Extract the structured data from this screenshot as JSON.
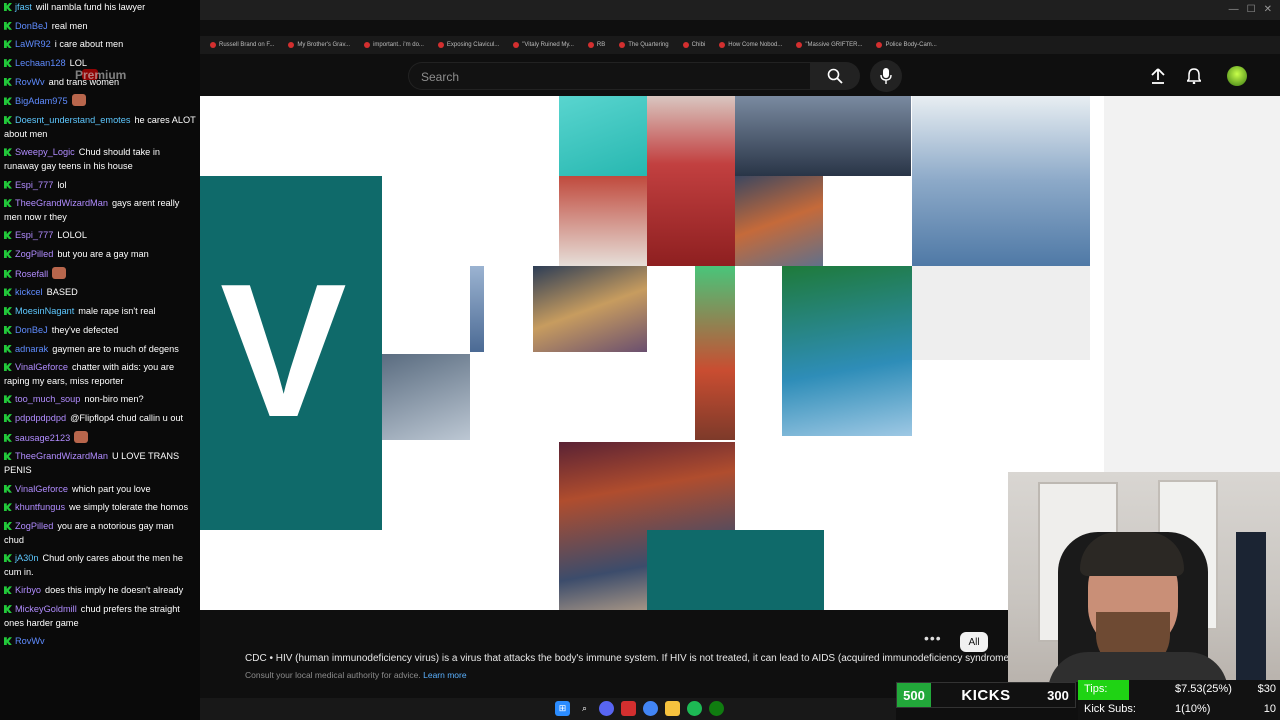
{
  "chat": {
    "messages": [
      {
        "user": "jfast",
        "text": "will nambla fund his lawyer",
        "uc": "c4"
      },
      {
        "user": "DonBeJ",
        "text": "real men",
        "uc": ""
      },
      {
        "user": "LaWR92",
        "text": "i care about men",
        "uc": ""
      },
      {
        "user": "Lechaan128",
        "text": "LOL",
        "uc": ""
      },
      {
        "user": "RovWv",
        "text": "and trans women",
        "uc": ""
      },
      {
        "user": "BigAdam975",
        "text": "",
        "uc": "",
        "emote": true
      },
      {
        "user": "Doesnt_understand_emotes",
        "text": "he cares ALOT about men",
        "uc": "c4"
      },
      {
        "user": "Sweepy_Logic",
        "text": "Chud should take in runaway gay teens in his house",
        "uc": "c3"
      },
      {
        "user": "Espi_777",
        "text": "lol",
        "uc": "c3"
      },
      {
        "user": "TheeGrandWizardMan",
        "text": "gays arent really men now r they",
        "uc": "c3"
      },
      {
        "user": "Espi_777",
        "text": "LOLOL",
        "uc": "c3"
      },
      {
        "user": "ZogPilled",
        "text": "but you are a gay man",
        "uc": "c3"
      },
      {
        "user": "Rosefall",
        "text": "",
        "uc": "c3",
        "emote": true
      },
      {
        "user": "kickcel",
        "text": "BASED",
        "uc": ""
      },
      {
        "user": "MoesinNagant",
        "text": "male rape isn't real",
        "uc": "c4"
      },
      {
        "user": "DonBeJ",
        "text": "they've defected",
        "uc": ""
      },
      {
        "user": "adnarak",
        "text": "gaymen are to much of degens",
        "uc": ""
      },
      {
        "user": "VinalGeforce",
        "text": "chatter with aids: you are raping my ears, miss reporter",
        "uc": "c3"
      },
      {
        "user": "too_much_soup",
        "text": "non-biro men?",
        "uc": "c3"
      },
      {
        "user": "pdpdpdpdpd",
        "text": "@Flipflop4 chud callin u out",
        "uc": "c3"
      },
      {
        "user": "sausage2123",
        "text": "",
        "uc": "c3",
        "emote": true
      },
      {
        "user": "TheeGrandWizardMan",
        "text": "U LOVE TRANS PENIS",
        "uc": "c3"
      },
      {
        "user": "VinalGeforce",
        "text": "which part you love",
        "uc": "c3"
      },
      {
        "user": "khuntfungus",
        "text": "we simply tolerate the homos",
        "uc": "c3"
      },
      {
        "user": "ZogPilled",
        "text": "you are a notorious gay man chud",
        "uc": "c3"
      },
      {
        "user": "jA30n",
        "text": "Chud only cares about the men he cum in.",
        "uc": "c4"
      },
      {
        "user": "Kirbyo",
        "text": "does this imply he doesn't already",
        "uc": "c3"
      },
      {
        "user": "MickeyGoldmill",
        "text": "chud prefers the straight ones harder game",
        "uc": "c3"
      },
      {
        "user": "RovWv",
        "text": "",
        "uc": ""
      }
    ]
  },
  "browser": {
    "bookmarks": [
      "Russell Brand on F...",
      "My Brother's Grav...",
      "important.. i'm do...",
      "Exposing Clavicul...",
      "\"Vitaly Ruined My...",
      "RB",
      "The Quartering",
      "Chibi",
      "How Come Nobod...",
      "\"Massive GRIFTER...",
      "Police Body-Cam..."
    ]
  },
  "header": {
    "premium_label": "Premium",
    "search_placeholder": "Search"
  },
  "description": {
    "text": "CDC • HIV (human immunodeficiency virus) is a virus that attacks the body's immune system. If HIV is not treated, it can lead to AIDS (acquired immunodeficiency syndrome).",
    "sub": "Consult your local medical authority for advice.",
    "learn_more": "Learn more",
    "chip_all": "All"
  },
  "kicks": {
    "left": "500",
    "label": "KICKS",
    "right": "300"
  },
  "stats": {
    "tips_label": "Tips:",
    "tips_value": "$7.53(25%)",
    "tips_goal": "$30",
    "tips_progress": 0.25,
    "subs_label": "Kick Subs:",
    "subs_value": "1(10%)",
    "subs_goal": "10"
  },
  "colors": {
    "accent_green": "#22c93a",
    "teal": "#0f6a6a",
    "username_blue": "#5f8cff"
  }
}
